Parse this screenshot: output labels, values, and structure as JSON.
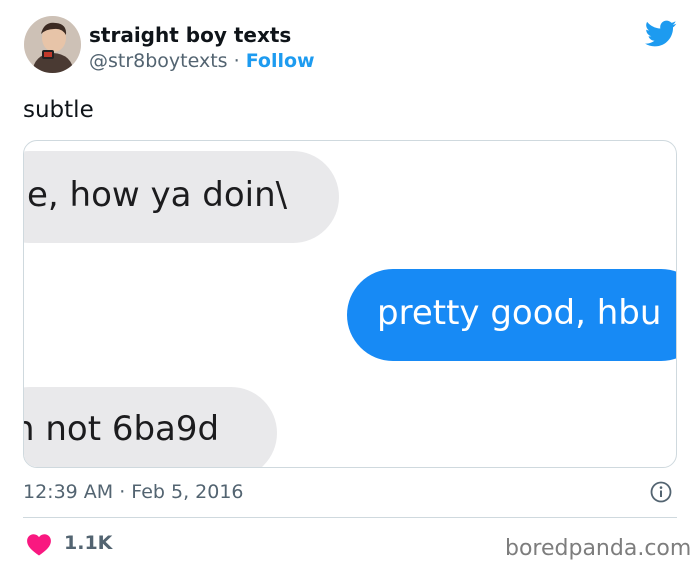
{
  "tweet": {
    "author": {
      "display_name": "straight boy texts",
      "handle": "@str8boytexts",
      "separator": " · ",
      "follow_label": "Follow"
    },
    "text": "subtle",
    "media": {
      "messages": [
        {
          "direction": "received",
          "text": "e, how ya doin\\"
        },
        {
          "direction": "sent",
          "text": "pretty good, hbu"
        },
        {
          "direction": "received",
          "text": "n not 6ba9d"
        }
      ]
    },
    "timestamp": "12:39 AM · Feb 5, 2016",
    "likes": "1.1K"
  },
  "icons": {
    "brand": "twitter-bird-icon",
    "info": "info-icon",
    "like": "heart-icon"
  },
  "colors": {
    "accent": "#1d9bf0",
    "like": "#f91880",
    "sent_bubble": "#178af5",
    "received_bubble": "#e9e9eb"
  },
  "watermark": "boredpanda.com"
}
